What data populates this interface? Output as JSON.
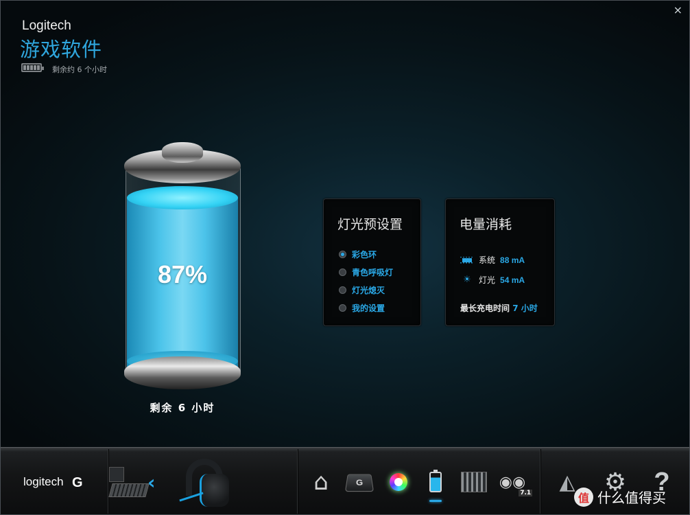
{
  "window": {
    "close_label": "×"
  },
  "header": {
    "brand": "Logitech",
    "title": "游戏软件",
    "remaining_short": "剩余约 6 个小时"
  },
  "battery": {
    "percent_label": "87%",
    "level": 0.87,
    "remaining": "剩余 6 小时"
  },
  "lighting_panel": {
    "title": "灯光预设置",
    "options": [
      {
        "label": "彩色环",
        "selected": true
      },
      {
        "label": "青色呼吸灯",
        "selected": false
      },
      {
        "label": "灯光熄灭",
        "selected": false
      },
      {
        "label": "我的设置",
        "selected": false
      }
    ]
  },
  "power_panel": {
    "title": "电量消耗",
    "system_label": "系统",
    "system_value": "88 mA",
    "light_label": "灯光",
    "light_value": "54 mA",
    "max_charge_label": "最长充电时间",
    "max_charge_value": "7 小时"
  },
  "bottom_bar": {
    "logo_text": "logitech",
    "logo_mark": "G",
    "back_arrow": "‹",
    "gkey_label": "G",
    "surround_badge": "7.1",
    "help_label": "?"
  },
  "watermark": {
    "text": "什么值得买",
    "mark": "值"
  },
  "colors": {
    "accent": "#2aa8e6",
    "title_blue": "#2fa6dd"
  }
}
